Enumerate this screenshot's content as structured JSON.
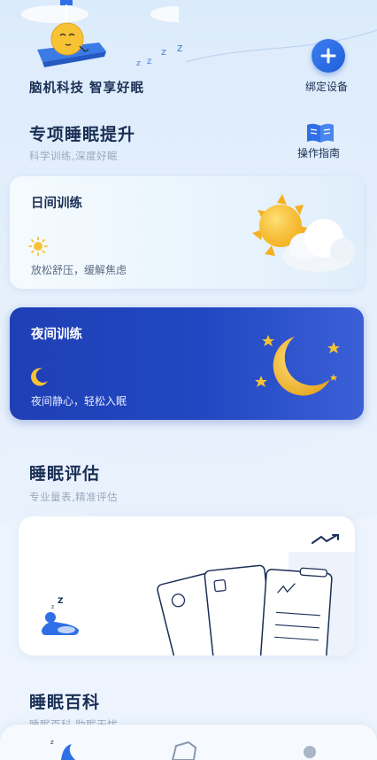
{
  "header": {
    "brand_text": "脑机科技 智享好眠",
    "bind_device_label": "绑定设备"
  },
  "special_training": {
    "title": "专项睡眠提升",
    "subtitle": "科学训练,深度好眠",
    "guide_label": "操作指南",
    "day_card": {
      "title": "日间训练",
      "desc": "放松舒压，缓解焦虑"
    },
    "night_card": {
      "title": "夜间训练",
      "desc": "夜间静心，轻松入眠"
    }
  },
  "sleep_eval": {
    "title": "睡眠评估",
    "subtitle": "专业量表,精准评估"
  },
  "sleep_wiki": {
    "title": "睡眠百科",
    "subtitle": "睡眠百科 助眠无忧"
  },
  "icons": [
    "plus-icon",
    "book-icon",
    "sun-icon",
    "moon-icon",
    "sleep-person-icon",
    "trend-arrow-icon"
  ],
  "colors": {
    "accent": "#2f6fe6",
    "title": "#1a2f55",
    "night_card": "#2148c2"
  }
}
